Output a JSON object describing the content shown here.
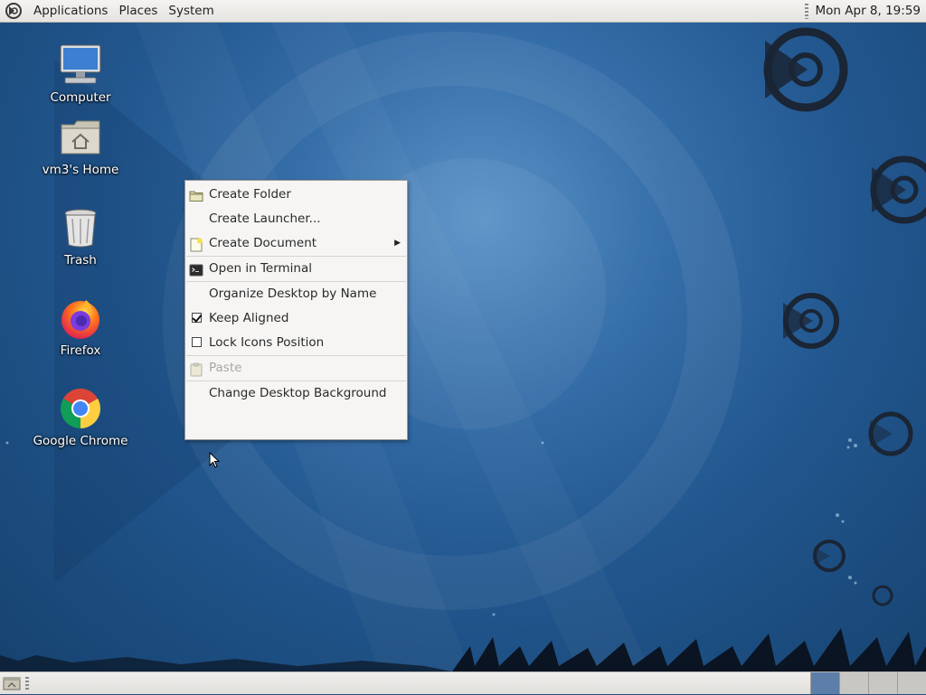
{
  "top_panel": {
    "menus": [
      "Applications",
      "Places",
      "System"
    ],
    "clock": "Mon Apr 8, 19:59"
  },
  "desktop": {
    "icons": [
      {
        "label": "Computer",
        "icon": "computer-icon"
      },
      {
        "label": "vm3's Home",
        "icon": "home-folder-icon"
      },
      {
        "label": "Trash",
        "icon": "trash-icon"
      },
      {
        "label": "Firefox",
        "icon": "firefox-icon"
      },
      {
        "label": "Google Chrome",
        "icon": "chrome-icon"
      }
    ]
  },
  "context_menu": {
    "create_folder": "Create Folder",
    "create_launcher": "Create Launcher...",
    "create_document": "Create Document",
    "open_terminal": "Open in Terminal",
    "organize_desktop": "Organize Desktop by Name",
    "keep_aligned": "Keep Aligned",
    "keep_aligned_checked": true,
    "lock_icons": "Lock Icons Position",
    "lock_icons_checked": false,
    "paste": "Paste",
    "change_background": "Change Desktop Background"
  },
  "bottom_panel": {
    "workspaces": 4,
    "active_workspace": 1
  },
  "colors": {
    "panel_bg": "#e6e4e0",
    "desktop_blue": "#22578f",
    "workspace_active": "#5c7ea8"
  }
}
